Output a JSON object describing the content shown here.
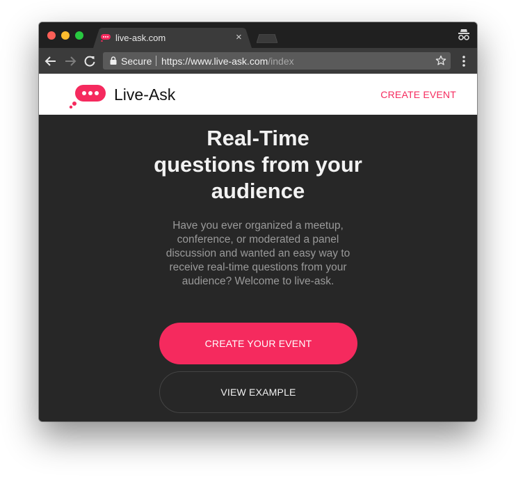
{
  "browser": {
    "tab": {
      "title": "live-ask.com",
      "close_label": "×"
    },
    "omnibox": {
      "secure_label": "Secure",
      "url_host": "https://www.live-ask.com",
      "url_path": "/index"
    },
    "icons": [
      "back-arrow-icon",
      "forward-arrow-icon",
      "reload-icon",
      "lock-icon",
      "star-icon",
      "more-menu-icon",
      "incognito-icon"
    ]
  },
  "site": {
    "brand": "Live-Ask",
    "header_cta": "CREATE EVENT",
    "accent_color": "#f52a5e",
    "hero": {
      "title": "Real-Time questions from your audience",
      "description": "Have you ever organized a meetup, conference, or moderated a panel discussion and wanted an easy way to receive real-time questions from your audience? Welcome to live-ask.",
      "primary_button": "CREATE YOUR EVENT",
      "secondary_button": "VIEW EXAMPLE"
    }
  }
}
